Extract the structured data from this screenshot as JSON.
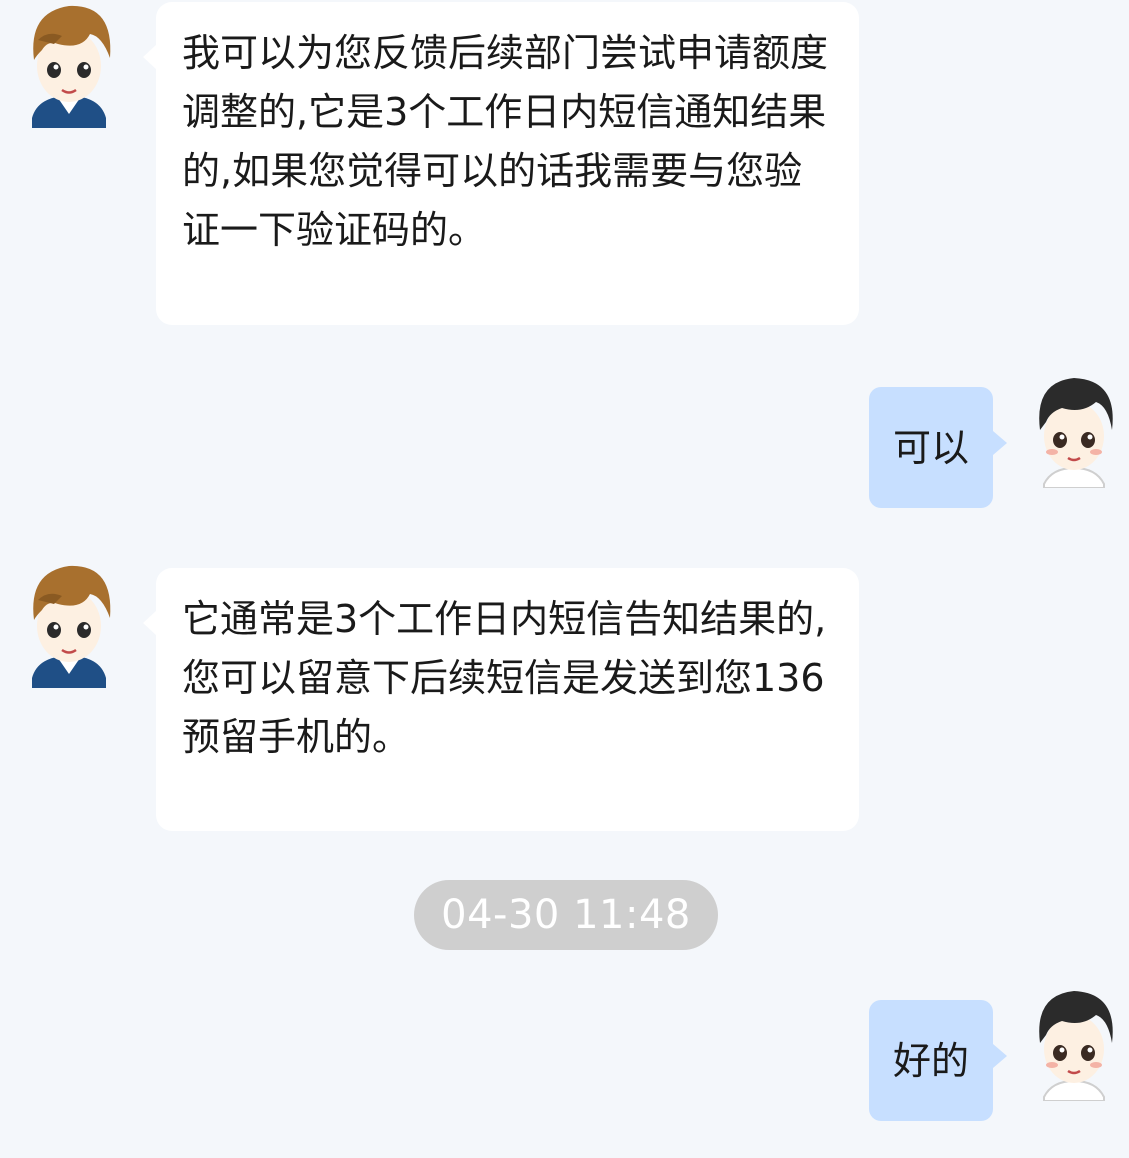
{
  "messages": [
    {
      "side": "incoming",
      "text": "我可以为您反馈后续部门尝试申请额度调整的,它是3个工作日内短信通知结果的,如果您觉得可以的话我需要与您验证一下验证码的。",
      "avatar_icon": "agent-cartoon-avatar-icon"
    },
    {
      "side": "outgoing",
      "text": "可以",
      "avatar_icon": "user-cartoon-avatar-icon"
    },
    {
      "side": "incoming",
      "text": "它通常是3个工作日内短信告知结果的,您可以留意下后续短信是发送到您136预留手机的。",
      "avatar_icon": "agent-cartoon-avatar-icon"
    },
    {
      "side": "outgoing",
      "text": "好的",
      "avatar_icon": "user-cartoon-avatar-icon"
    }
  ],
  "timestamp": "04-30 11:48",
  "colors": {
    "background": "#f4f7fb",
    "incoming_bubble": "#ffffff",
    "outgoing_bubble": "#c7dfff",
    "timestamp_pill": "#cfcfcf",
    "agent_hair": "#a8702e",
    "user_hair": "#2b2b2b"
  }
}
